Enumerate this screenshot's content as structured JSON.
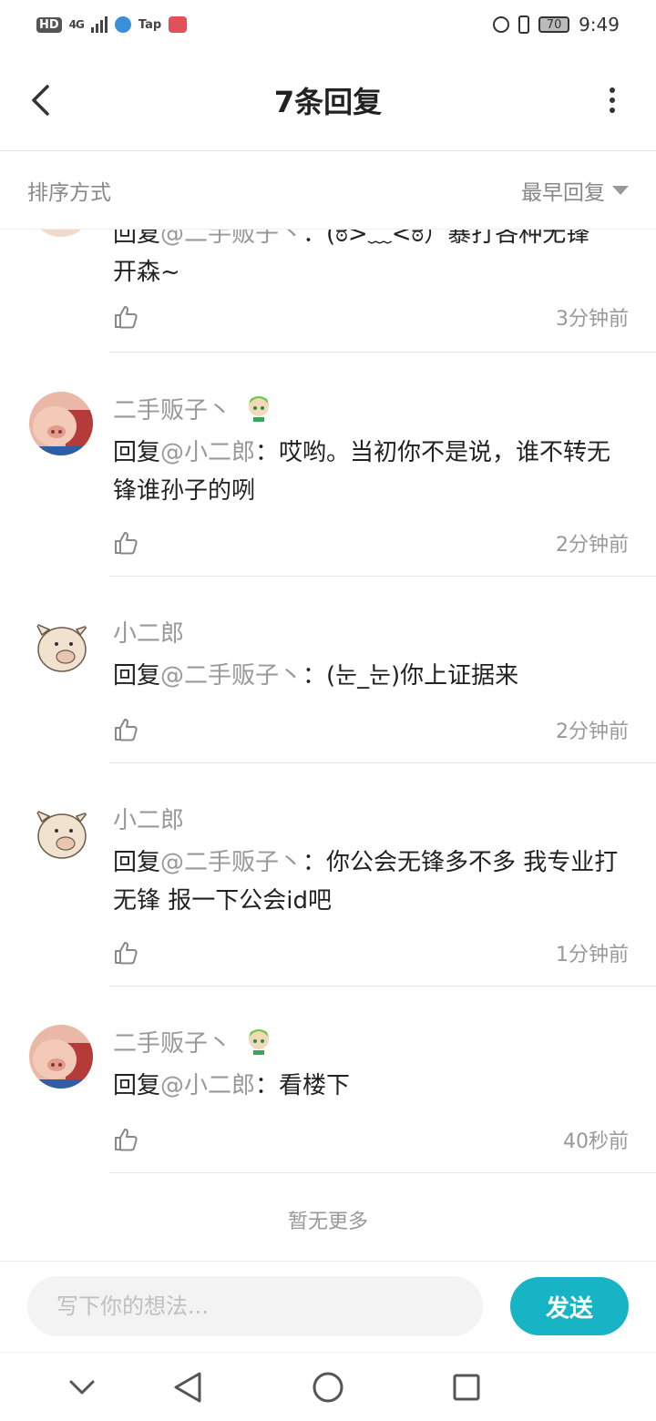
{
  "status_bar": {
    "hd": "HD",
    "network": "4G",
    "tap": "Tap",
    "battery": "70",
    "time": "9:49"
  },
  "header": {
    "title": "7条回复",
    "back_icon": "chevron-left-icon",
    "more_icon": "more-vertical-icon"
  },
  "sort": {
    "label": "排序方式",
    "selected": "最早回复"
  },
  "replies": [
    {
      "partial": true,
      "text_line1_prefix": "回复",
      "text_line1_mention": "@二手贩子丶",
      "text_line1_rest": "：(ಠ>﹏<ಠ）暴打各种无锋",
      "text_line2": "开森~",
      "time": "3分钟前"
    },
    {
      "author": "二手贩子丶",
      "has_badge": true,
      "prefix": "回复",
      "mention": "@小二郎",
      "body": "：哎哟。当初你不是说，谁不转无锋谁孙子的咧",
      "time": "2分钟前"
    },
    {
      "author": "小二郎",
      "has_badge": false,
      "prefix": "回复",
      "mention": "@二手贩子丶",
      "body": "：(눈_눈)你上证据来",
      "time": "2分钟前"
    },
    {
      "author": "小二郎",
      "has_badge": false,
      "prefix": "回复",
      "mention": "@二手贩子丶",
      "body": "：你公会无锋多不多 我专业打无锋 报一下公会id吧",
      "time": "1分钟前"
    },
    {
      "author": "二手贩子丶",
      "has_badge": true,
      "prefix": "回复",
      "mention": "@小二郎",
      "body": "：看楼下",
      "time": "40秒前"
    }
  ],
  "footer_note": "暂无更多",
  "composer": {
    "placeholder": "写下你的想法...",
    "send_label": "发送"
  },
  "colors": {
    "accent": "#16b4c4",
    "muted_text": "#999999",
    "primary_text": "#222222"
  }
}
